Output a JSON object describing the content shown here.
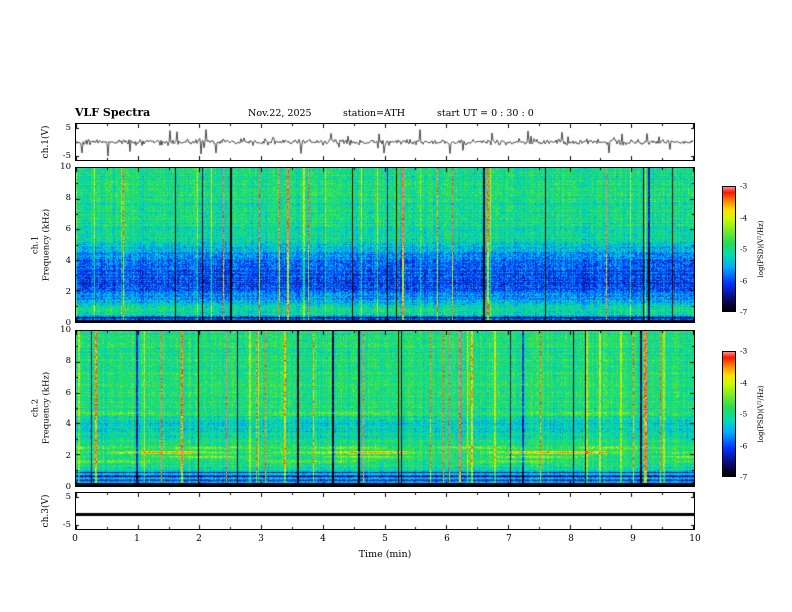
{
  "header": {
    "title": "VLF  Spectra",
    "date": "Nov.22, 2025",
    "station": "station=ATH",
    "start_ut": "start UT  =   0 : 30 : 0"
  },
  "left_labels": {
    "ch1v": "ch.1(V)",
    "spec1_line1": "ch.1",
    "spec1_line2": "Frequency (kHz)",
    "spec2_line1": "ch.2",
    "spec2_line2": "Frequency (kHz)",
    "ch3v": "ch.3(V)"
  },
  "axes": {
    "wave_ticks": [
      "5",
      "-5"
    ],
    "spec_ticks": [
      "10",
      "8",
      "6",
      "4",
      "2",
      "0"
    ],
    "x_ticks": [
      "0",
      "1",
      "2",
      "3",
      "4",
      "5",
      "6",
      "7",
      "8",
      "9",
      "10"
    ],
    "x_label": "Time  (min)"
  },
  "colorbar": {
    "ticks": [
      "-3",
      "-4",
      "-5",
      "-6",
      "-7"
    ],
    "label": "log(PSD)(V²/Hz)"
  },
  "colormap": [
    [
      0.0,
      [
        0,
        0,
        0
      ]
    ],
    [
      0.1,
      [
        10,
        10,
        120
      ]
    ],
    [
      0.22,
      [
        0,
        50,
        255
      ]
    ],
    [
      0.35,
      [
        0,
        170,
        255
      ]
    ],
    [
      0.45,
      [
        0,
        220,
        180
      ]
    ],
    [
      0.55,
      [
        40,
        220,
        80
      ]
    ],
    [
      0.65,
      [
        120,
        235,
        40
      ]
    ],
    [
      0.75,
      [
        210,
        250,
        0
      ]
    ],
    [
      0.82,
      [
        255,
        220,
        0
      ]
    ],
    [
      0.9,
      [
        255,
        120,
        0
      ]
    ],
    [
      0.96,
      [
        255,
        20,
        0
      ]
    ],
    [
      1.0,
      [
        255,
        130,
        130
      ]
    ]
  ],
  "chart_data": [
    {
      "type": "line",
      "name": "ch1_waveform",
      "ylabel": "ch.1(V)",
      "xlim": [
        0,
        10
      ],
      "ylim": [
        -5,
        5
      ],
      "yticks": [
        5,
        -5
      ],
      "description": "Noisy broadband VLF waveform, ~±1 V background with frequent impulsive sferic spikes reaching ±5 V",
      "synthesis": {
        "seed": 42,
        "noise_rms": 1.0,
        "spike_prob": 0.06,
        "spike_amp": 3.5,
        "ytickvals": [
          5,
          -5
        ]
      }
    },
    {
      "type": "heatmap",
      "name": "ch1_spectrogram",
      "ylabel": "ch.1 Frequency (kHz)",
      "xlim": [
        0,
        10
      ],
      "ylim": [
        0,
        10
      ],
      "zlabel": "log(PSD)(V²/Hz)",
      "zlim": [
        -7,
        -3
      ],
      "description": "Spectrogram: green background with blue suppressed band 2-4 kHz, dense vertical sferic stripes (bright and dark), black line at 0 kHz",
      "synthesis": {
        "seed": 7,
        "fmax": 10,
        "noise": 0.22,
        "row_striation": 0.09,
        "bright_stripe_prob": 0.055,
        "dark_stripe_prob": 0.022,
        "black_below": 0.13,
        "profile": [
          [
            0,
            0.32
          ],
          [
            0.3,
            0.34
          ],
          [
            0.5,
            0.46
          ],
          [
            0.9,
            0.44
          ],
          [
            1.4,
            0.36
          ],
          [
            2.0,
            0.28
          ],
          [
            2.6,
            0.24
          ],
          [
            3.4,
            0.25
          ],
          [
            4.2,
            0.3
          ],
          [
            4.8,
            0.4
          ],
          [
            5.5,
            0.47
          ],
          [
            7.0,
            0.5
          ],
          [
            10,
            0.5
          ]
        ],
        "bands": [
          {
            "f": 0.25,
            "w": 0.04,
            "amp": -0.3
          },
          {
            "f": 0.7,
            "w": 0.12,
            "amp": 0.07,
            "period": 5,
            "phase": 0.2
          }
        ]
      }
    },
    {
      "type": "heatmap",
      "name": "ch2_spectrogram",
      "ylabel": "ch.2 Frequency (kHz)",
      "xlim": [
        0,
        10
      ],
      "ylim": [
        0,
        10
      ],
      "zlabel": "log(PSD)(V²/Hz)",
      "zlim": [
        -7,
        -3
      ],
      "description": "Spectrogram: green background, bright orange/red intermittent horizontal bands 1.5-2.5 kHz, dark striations below 1 kHz, vertical sferic stripes",
      "synthesis": {
        "seed": 13,
        "fmax": 10,
        "noise": 0.2,
        "row_striation": 0.09,
        "bright_stripe_prob": 0.05,
        "dark_stripe_prob": 0.02,
        "black_below": 0.13,
        "profile": [
          [
            0,
            0.36
          ],
          [
            0.4,
            0.42
          ],
          [
            1.0,
            0.44
          ],
          [
            1.3,
            0.5
          ],
          [
            2.7,
            0.52
          ],
          [
            3.2,
            0.45
          ],
          [
            4.0,
            0.43
          ],
          [
            4.6,
            0.49
          ],
          [
            5.2,
            0.52
          ],
          [
            8.0,
            0.52
          ],
          [
            10,
            0.5
          ]
        ],
        "bands": [
          {
            "f": 0.35,
            "w": 0.04,
            "amp": -0.26
          },
          {
            "f": 0.6,
            "w": 0.05,
            "amp": -0.3
          },
          {
            "f": 0.85,
            "w": 0.04,
            "amp": -0.22
          },
          {
            "f": 1.55,
            "w": 0.05,
            "amp": 0.2,
            "period": 3.3,
            "phase": 0.1
          },
          {
            "f": 1.85,
            "w": 0.05,
            "amp": 0.24,
            "period": 2.7,
            "phase": 0.5
          },
          {
            "f": 2.15,
            "w": 0.06,
            "amp": 0.22,
            "period": 3.1,
            "phase": 0.8,
            "segments": [
              [
                1.05,
                1.9
              ],
              [
                4.4,
                5.35
              ],
              [
                7.0,
                8.6
              ]
            ]
          },
          {
            "f": 2.45,
            "w": 0.05,
            "amp": 0.15,
            "period": 2.2,
            "phase": 0.3
          },
          {
            "f": 4.7,
            "w": 0.08,
            "amp": 0.09,
            "period": 4.0,
            "phase": 0.2
          }
        ]
      }
    },
    {
      "type": "line",
      "name": "ch3_waveform",
      "ylabel": "ch.3(V)",
      "xlim": [
        0,
        10
      ],
      "ylim": [
        -5,
        5
      ],
      "yticks": [
        5,
        -5
      ],
      "description": "Flat (inactive) channel: constant thick black trace near -1 V",
      "synthesis": {
        "seed": 99,
        "flat": -1,
        "ytickvals": [
          5,
          -5
        ]
      }
    }
  ]
}
